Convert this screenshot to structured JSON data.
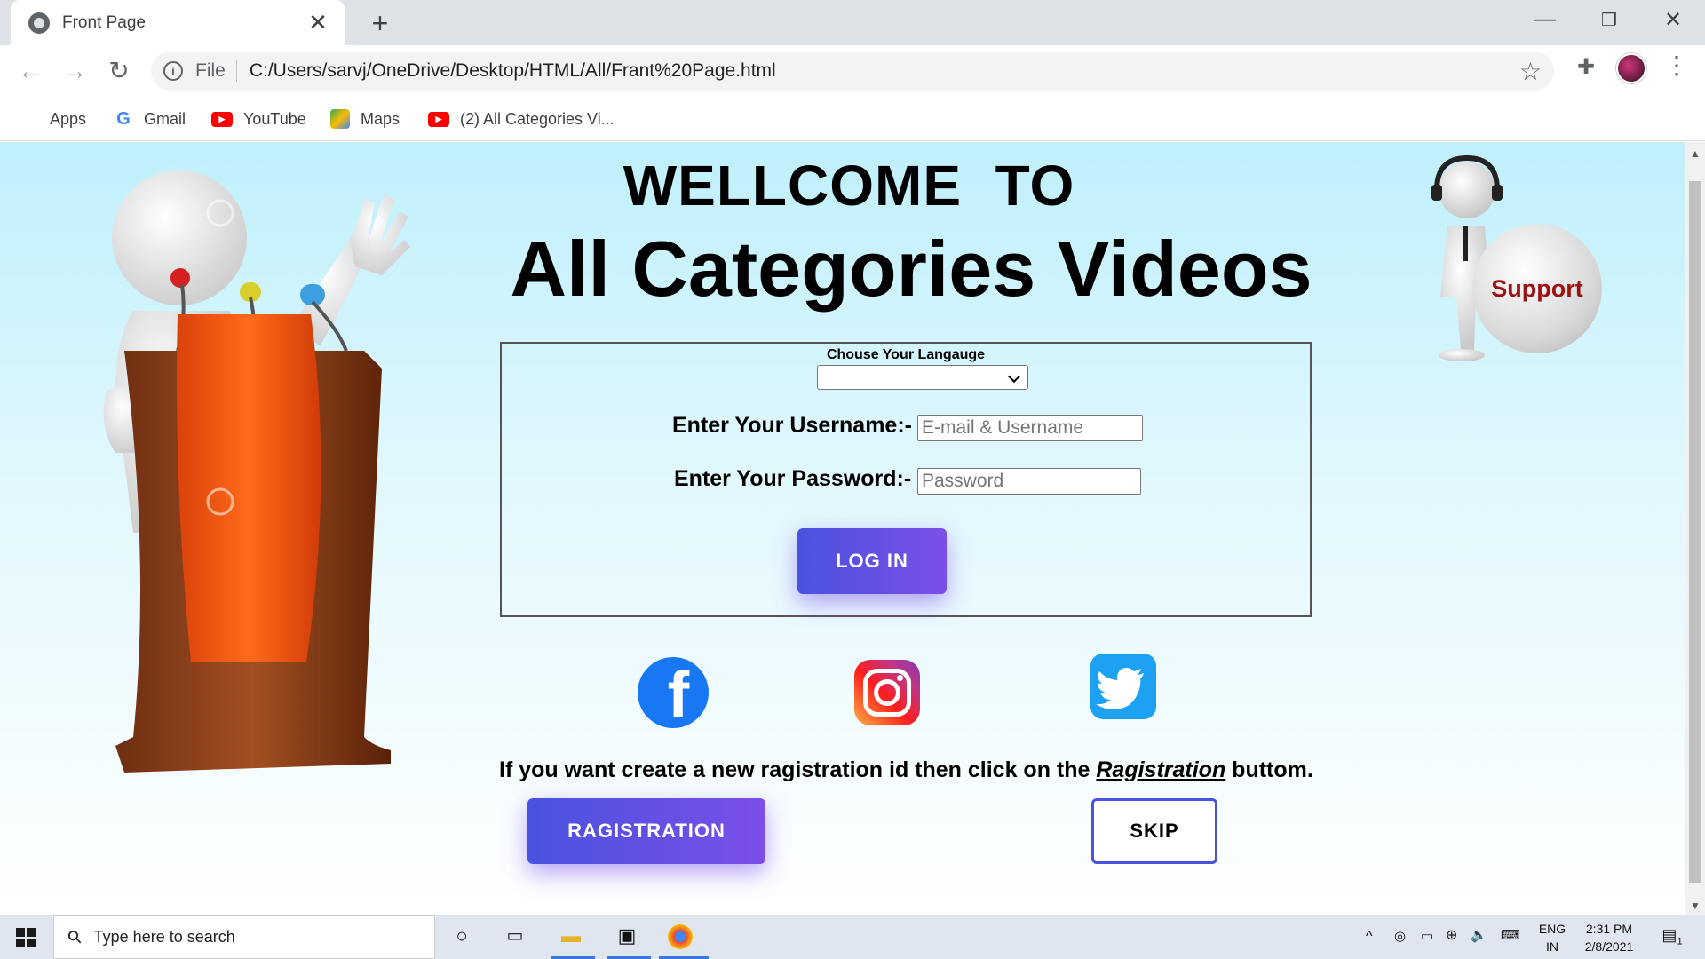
{
  "browser": {
    "tab_title": "Front Page",
    "tab_close": "✕",
    "new_tab": "+",
    "file_label": "File",
    "url": "C:/Users/sarvj/OneDrive/Desktop/HTML/All/Frant%20Page.html",
    "bookmarks": [
      "Apps",
      "Gmail",
      "YouTube",
      "Maps",
      "(2) All Categories Vi..."
    ]
  },
  "page": {
    "welcome": "WELLCOME  TO",
    "title": "All Categories Videos",
    "language_label": "Chouse Your Langauge",
    "language_selected": "",
    "username_label": "Enter Your Username:-",
    "username_placeholder": "E-mail & Username",
    "password_label": "Enter Your Password:-",
    "password_placeholder": "Password",
    "login_button": "LOG IN",
    "registration_text_pre": "If you want create a new ragistration id then click on the ",
    "registration_text_link": "Ragistration",
    "registration_text_post": " buttom.",
    "registration_button": "RAGISTRATION",
    "skip_button": "SKIP",
    "support_label": "Support",
    "facebook_letter": "f",
    "colors": {
      "button_start": "#4a52e0",
      "button_end": "#7b4fe8",
      "support_text": "#9c1111"
    }
  },
  "taskbar": {
    "search_placeholder": "Type here to search",
    "lang": "ENG",
    "region": "IN",
    "time": "2:31 PM",
    "date": "2/8/2021",
    "notification_count": "1"
  }
}
